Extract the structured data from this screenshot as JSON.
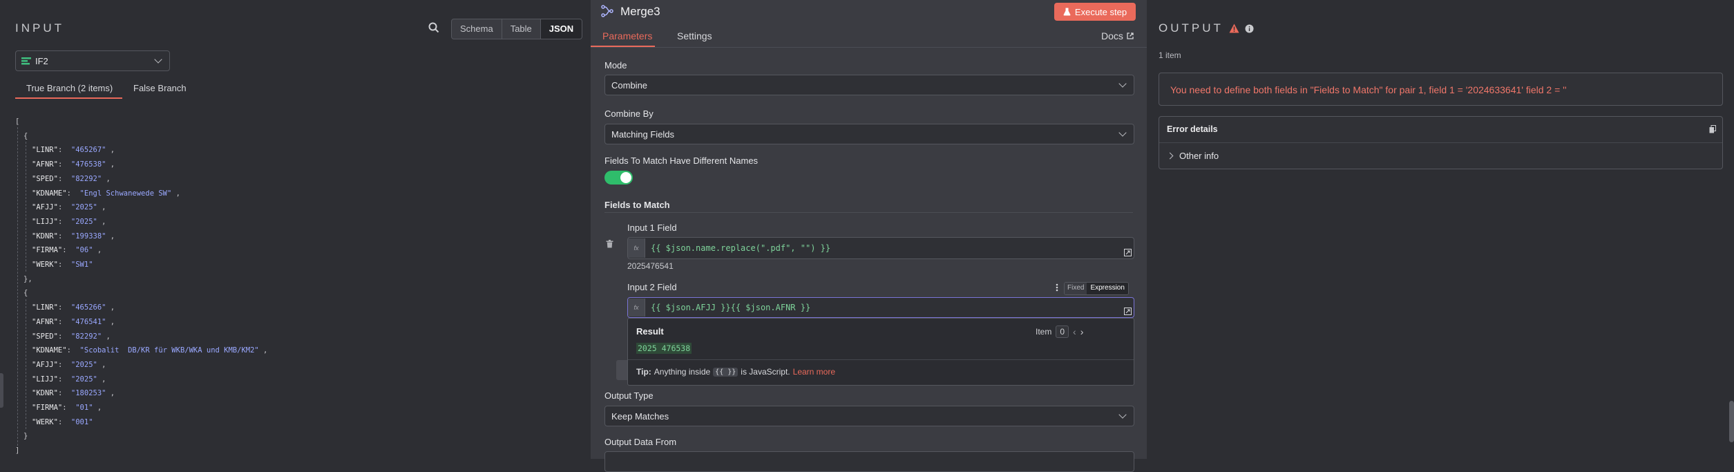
{
  "input": {
    "title": "INPUT",
    "view_modes": [
      "Schema",
      "Table",
      "JSON"
    ],
    "active_view": "JSON",
    "node_select": "IF2",
    "branch_tabs": [
      "True Branch (2 items)",
      "False Branch"
    ],
    "json_lines": [
      {
        "t": "[",
        "i": 0
      },
      {
        "t": "{",
        "i": 1
      },
      {
        "k": "\"LINR\"",
        "v": "\"465267\"",
        "i": 2
      },
      {
        "k": "\"AFNR\"",
        "v": "\"476538\"",
        "i": 2
      },
      {
        "k": "\"SPED\"",
        "v": "\"82292\"",
        "i": 2
      },
      {
        "k": "\"KDNAME\"",
        "v": "\"Engl Schwanewede SW\"",
        "i": 2
      },
      {
        "k": "\"AFJJ\"",
        "v": "\"2025\"",
        "i": 2
      },
      {
        "k": "\"LIJJ\"",
        "v": "\"2025\"",
        "i": 2
      },
      {
        "k": "\"KDNR\"",
        "v": "\"199338\"",
        "i": 2
      },
      {
        "k": "\"FIRMA\"",
        "v": "\"06\"",
        "i": 2
      },
      {
        "k": "\"WERK\"",
        "v": "\"SW1\"",
        "i": 2,
        "last": true
      },
      {
        "t": "},",
        "i": 1
      },
      {
        "t": "{",
        "i": 1
      },
      {
        "k": "\"LINR\"",
        "v": "\"465266\"",
        "i": 2
      },
      {
        "k": "\"AFNR\"",
        "v": "\"476541\"",
        "i": 2
      },
      {
        "k": "\"SPED\"",
        "v": "\"82292\"",
        "i": 2
      },
      {
        "k": "\"KDNAME\"",
        "v": "\"Scobalit  DB/KR für WKB/WKA und KMB/KM2\"",
        "i": 2
      },
      {
        "k": "\"AFJJ\"",
        "v": "\"2025\"",
        "i": 2
      },
      {
        "k": "\"LIJJ\"",
        "v": "\"2025\"",
        "i": 2
      },
      {
        "k": "\"KDNR\"",
        "v": "\"180253\"",
        "i": 2
      },
      {
        "k": "\"FIRMA\"",
        "v": "\"01\"",
        "i": 2
      },
      {
        "k": "\"WERK\"",
        "v": "\"001\"",
        "i": 2,
        "last": true
      },
      {
        "t": "}",
        "i": 1
      },
      {
        "t": "]",
        "i": 0
      }
    ]
  },
  "node": {
    "title": "Merge3",
    "execute_label": "Execute step",
    "tabs": [
      "Parameters",
      "Settings"
    ],
    "docs_label": "Docs",
    "mode_label": "Mode",
    "mode_value": "Combine",
    "combine_by_label": "Combine By",
    "combine_by_value": "Matching Fields",
    "diff_names_label": "Fields To Match Have Different Names",
    "diff_names_on": true,
    "fields_to_match_label": "Fields to Match",
    "input1_label": "Input 1 Field",
    "input1_expr": "{{ $json.name.replace(\".pdf\", \"\") }}",
    "input1_preview": "2025476541",
    "input2_label": "Input 2 Field",
    "input2_mode_fixed": "Fixed",
    "input2_mode_expression": "Expression",
    "input2_expr": "{{ $json.AFJJ }}{{ $json.AFNR }}",
    "result_label": "Result",
    "item_label": "Item",
    "item_index": "0",
    "result_value": "2025 476538",
    "tip_prefix": "Tip:",
    "tip_text_1": "Anything inside",
    "tip_code": "{{ }}",
    "tip_text_2": "is JavaScript.",
    "tip_link": "Learn more",
    "output_type_label": "Output Type",
    "output_type_value": "Keep Matches",
    "output_data_from_label": "Output Data From"
  },
  "output": {
    "title": "OUTPUT",
    "item_count": "1 item",
    "error_message": "You need to define both fields in \"Fields to Match\" for pair 1, field 1 = '2024633641' field 2 = ''",
    "error_details_label": "Error details",
    "other_info_label": "Other info"
  },
  "colors": {
    "accent": "#ea6a5b",
    "json_value": "#9aa8ff",
    "expression_green": "#7ed39a",
    "toggle_green": "#2fbd6b",
    "error_text": "#f0776a"
  }
}
